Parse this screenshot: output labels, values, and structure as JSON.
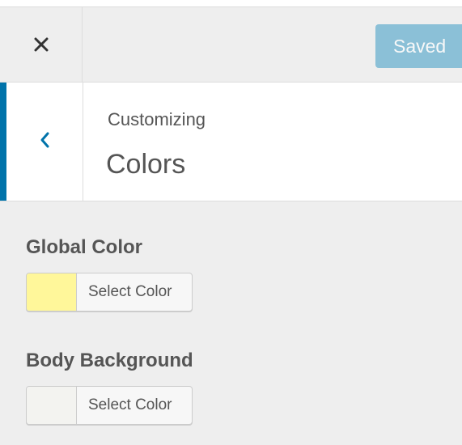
{
  "header": {
    "close_icon": "close-icon",
    "saved_label": "Saved"
  },
  "section": {
    "back_icon": "chevron-left-icon",
    "breadcrumb": "Customizing",
    "title": "Colors"
  },
  "controls": [
    {
      "label": "Global Color",
      "button_label": "Select Color",
      "swatch_color": "#fff79a"
    },
    {
      "label": "Body Background",
      "button_label": "Select Color",
      "swatch_color": "#f3f3f0"
    }
  ],
  "colors": {
    "accent": "#0073aa",
    "button_primary": "#0085ba"
  }
}
